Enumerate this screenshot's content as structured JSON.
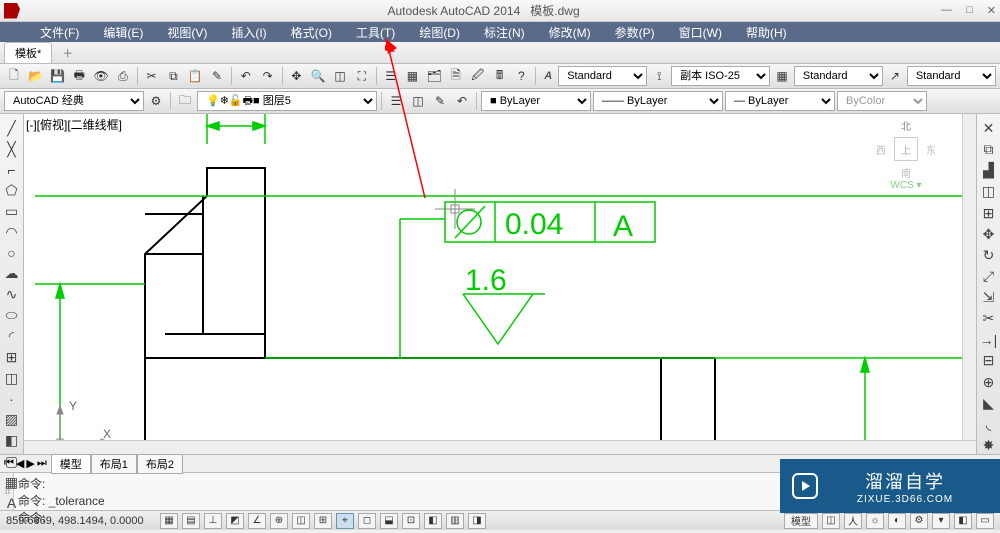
{
  "title": {
    "app": "Autodesk AutoCAD 2014",
    "file": "模板.dwg"
  },
  "window_controls": {
    "min": "—",
    "max": "□",
    "close": "✕"
  },
  "menu": [
    {
      "label": "文件(F)"
    },
    {
      "label": "编辑(E)"
    },
    {
      "label": "视图(V)"
    },
    {
      "label": "插入(I)"
    },
    {
      "label": "格式(O)"
    },
    {
      "label": "工具(T)"
    },
    {
      "label": "绘图(D)"
    },
    {
      "label": "标注(N)"
    },
    {
      "label": "修改(M)"
    },
    {
      "label": "参数(P)"
    },
    {
      "label": "窗口(W)"
    },
    {
      "label": "帮助(H)"
    }
  ],
  "doc_tab": {
    "label": "模板*",
    "plus": "＋"
  },
  "toolbar1": {
    "icons": [
      "new-icon",
      "open-icon",
      "save-icon",
      "print-icon",
      "plot-preview-icon",
      "publish-icon",
      "cut-icon",
      "copy-icon",
      "paste-icon",
      "match-icon",
      "undo-icon",
      "redo-icon",
      "pan-icon",
      "zoom-icon",
      "zoom-window-icon",
      "zoom-extents-icon",
      "properties-icon",
      "design-center-icon",
      "tool-palettes-icon",
      "sheet-set-icon",
      "markup-icon",
      "calc-icon",
      "help-icon"
    ],
    "glyphs": [
      "🗋",
      "📂",
      "💾",
      "🖶",
      "👁",
      "⎙",
      "✂",
      "⧉",
      "📋",
      "✎",
      "↶",
      "↷",
      "✥",
      "🔍",
      "◫",
      "⛶",
      "☰",
      "▦",
      "🗂",
      "🗎",
      "🖉",
      "🖩",
      "?"
    ],
    "textstyle": "Standard",
    "dimstyle": "副本 ISO-25",
    "tablestyle": "Standard",
    "mleaderstyle": "Standard"
  },
  "toolbar2": {
    "workspace": "AutoCAD 经典",
    "layer": "图层5",
    "linetype": "ByLayer",
    "bylayer2": "ByLayer",
    "bylayer3": "ByLayer",
    "color": "ByColor"
  },
  "viewport": {
    "label": "[-][俯视][二维线框]"
  },
  "navcube": {
    "north": "北",
    "west": "西",
    "east": "东",
    "south": "南",
    "top": "上",
    "wcs": "WCS ▾"
  },
  "drawing": {
    "tol_value": "0.04",
    "tol_datum": "A",
    "surf_value": "1.6"
  },
  "layout_tabs": {
    "arrows": [
      "⏮",
      "◀",
      "▶",
      "⏭"
    ],
    "tabs": [
      "模型",
      "布局1",
      "布局2"
    ]
  },
  "cmdline": {
    "line1": "命令:",
    "line2": "命令: _tolerance",
    "prompt": "命令:"
  },
  "status": {
    "coords": "859.6669, 498.1494, 0.0000",
    "model_btn": "模型",
    "buttons_glyphs": [
      "▦",
      "▤",
      "⊥",
      "◩",
      "∠",
      "⊕",
      "◫",
      "⊞",
      "⌖",
      "◻",
      "⬓",
      "⊡",
      "◧",
      "▥",
      "◨"
    ],
    "right_glyphs": [
      "◫",
      "人",
      "☼",
      "◐",
      "⚙",
      "▾",
      "◧",
      "▭"
    ]
  },
  "watermark": {
    "zh": "溜溜自学",
    "url": "ZIXUE.3D66.COM"
  }
}
